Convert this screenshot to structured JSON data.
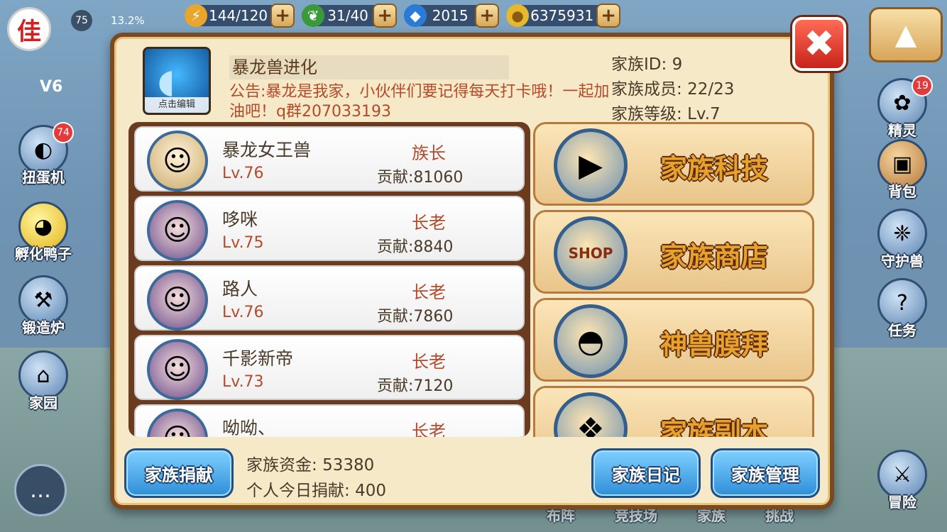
{
  "topbar": {
    "stamina": "144/120",
    "energy": "31/40",
    "diamonds": "2015",
    "gold": "6375931",
    "plus": "+"
  },
  "player": {
    "avatar_char": "佳",
    "level": "75",
    "exp_percent": "13.2%",
    "vip": "V6"
  },
  "left_menu": [
    {
      "label": "扭蛋机",
      "badge": "74"
    },
    {
      "label": "孵化鸭子",
      "badge": ""
    },
    {
      "label": "锻造炉",
      "badge": ""
    },
    {
      "label": "家园",
      "badge": ""
    }
  ],
  "right_menu": [
    {
      "label": "精灵",
      "badge": "19"
    },
    {
      "label": "背包",
      "badge": ""
    },
    {
      "label": "守护兽",
      "badge": ""
    },
    {
      "label": "任务",
      "badge": ""
    }
  ],
  "right_bottom": {
    "label": "冒险"
  },
  "bottom_nav": [
    "布阵",
    "竞技场",
    "家族",
    "挑战"
  ],
  "dialog": {
    "close_icon": "✖",
    "family_icon_edit": "点击编辑",
    "family_name": "暴龙兽进化",
    "notice": "公告:暴龙是我家，小伙伴们要记得每天打卡哦！一起加油吧！q群207033193",
    "info": {
      "id_label": "家族ID:",
      "id_value": "9",
      "members_label": "家族成员:",
      "members_value": "22/23",
      "level_label": "家族等级:",
      "level_value": "Lv.7"
    },
    "members": [
      {
        "name": "暴龙女王兽",
        "level": "Lv.76",
        "role": "族长",
        "contribution": "贡献:81060"
      },
      {
        "name": "哆咪",
        "level": "Lv.75",
        "role": "长老",
        "contribution": "贡献:8840"
      },
      {
        "name": "路人",
        "level": "Lv.76",
        "role": "长老",
        "contribution": "贡献:7860"
      },
      {
        "name": "千影新帝",
        "level": "Lv.73",
        "role": "长老",
        "contribution": "贡献:7120"
      },
      {
        "name": "呦呦、",
        "level": "",
        "role": "长老",
        "contribution": ""
      }
    ],
    "features": [
      {
        "label": "家族科技",
        "icon": "book-icon"
      },
      {
        "label": "家族商店",
        "icon": "shop-icon"
      },
      {
        "label": "神兽膜拜",
        "icon": "helmet-icon"
      },
      {
        "label": "家族副本",
        "icon": "dragon-icon"
      }
    ],
    "donate_button": "家族捐献",
    "funds_label": "家族资金:",
    "funds_value": "53380",
    "today_label": "个人今日捐献:",
    "today_value": "400",
    "diary_button": "家族日记",
    "manage_button": "家族管理"
  }
}
